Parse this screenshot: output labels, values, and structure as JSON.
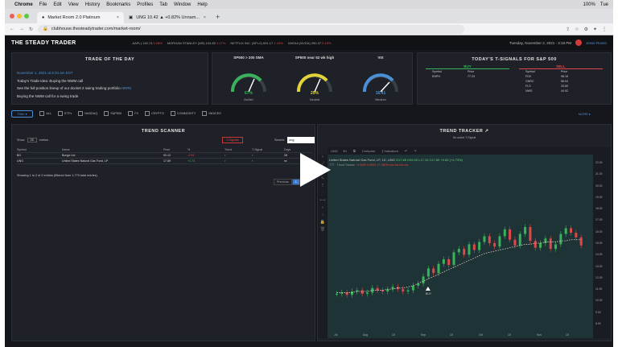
{
  "menubar": {
    "apple": "",
    "app": "Chrome",
    "items": [
      "File",
      "Edit",
      "View",
      "History",
      "Bookmarks",
      "Profiles",
      "Tab",
      "Window",
      "Help"
    ],
    "status": "100%",
    "clock": "Tue"
  },
  "tabs": [
    {
      "label": "Market Room 2.0 Platinum",
      "active": true
    },
    {
      "label": "UNG 10.42 ▲ +0.82% Unnam...",
      "active": false
    }
  ],
  "address": {
    "url": "clubhouse.thesteadytrader.com/market-room/"
  },
  "header": {
    "logo": "THE STEADY TRADER",
    "ticker": [
      {
        "t": "AAPL) 149.74",
        "r": "0.28%"
      },
      {
        "t": "MORGAN STANLEY (MS) 104.83",
        "r": "1.17%"
      },
      {
        "t": "NETFLIX INC. (NFLX) 691.17",
        "r": "1.19%"
      },
      {
        "t": "NVIDIA (NVDA) 250.37",
        "r": "0.19%"
      }
    ],
    "date": "Tuesday, November 2, 2021 - 3:18 PM",
    "user": "Jesse Rosen"
  },
  "trade_of_day": {
    "title": "TRADE OF THE DAY",
    "date": "November 1, 2021 at 9:34 am EST",
    "lines": [
      "Today's Trade Idea: Buying the NWM call",
      "See the full position lineup of our docket 2 swing trading portfolio",
      "Buying the NWM call for a swing trade"
    ],
    "link": "HERE"
  },
  "gauges": [
    {
      "title": "SP500 > 200 SMA",
      "value": "67%",
      "label": "Bullish",
      "color": "#39b35b"
    },
    {
      "title": "SP500 near 52 wk high",
      "value": "29%",
      "label": "Neutral",
      "color": "#e0d43a"
    },
    {
      "title": "VIX",
      "value": "16.41",
      "label": "Medium",
      "color": "#4b8fd6"
    }
  ],
  "signals": {
    "title": "TODAY'S T-SIGNALS FOR S&P 500",
    "buy": {
      "label": "BUY",
      "color": "#39b35b",
      "headers": [
        "Symbol",
        "Price"
      ],
      "rows": [
        [
          "ENPH",
          "77.23"
        ]
      ]
    },
    "sell": {
      "label": "SELL",
      "color": "#e04848",
      "headers": [
        "Symbol",
        "Price"
      ],
      "rows": [
        [
          "FDX",
          "98.16"
        ],
        [
          "GNRC",
          "56.04"
        ],
        [
          "FLS",
          "33.89"
        ],
        [
          "NWS",
          "44.92"
        ]
      ]
    }
  },
  "filters": {
    "button": "Filter ▾",
    "items": [
      "ALL",
      "ETFs",
      "NASDAQ",
      "S&P500",
      "FX",
      "CRYPTO",
      "COMMODITY",
      "INDICES"
    ],
    "more": "MORE ▸"
  },
  "scanner": {
    "title": "TREND SCANNER",
    "show": "Show",
    "entries_val": "25",
    "entries": "entries",
    "tsignal": "T-Signals",
    "search_label": "Search:",
    "search_value": "ung",
    "headers": [
      "Symbol",
      "Name",
      "Price",
      "%",
      "Trend",
      "T-Signal",
      "Days"
    ],
    "rows": [
      [
        "BG",
        "Bunge Ltd",
        "92.12",
        "-0.94",
        "↑",
        "↑",
        "28"
      ],
      [
        "UNG",
        "United States Natural Gas Fund, LP",
        "17.89",
        "+4.73",
        "↑",
        "↑",
        "xx"
      ]
    ],
    "showing": "Showing 1 to 2 of 2 entries (filtered from 1,779 total entries)",
    "prev": "Previous",
    "page": "1"
  },
  "tracker": {
    "title": "TREND TRACKER ↗",
    "subtitle": "No active T-Signal",
    "symbol": "UNG",
    "toolbar": [
      "1D",
      "⧉",
      "Compare",
      "⨍ Indicators",
      "↶",
      "↷"
    ],
    "legend1": "United States Natural Gas Fund, LP, 1D, UNG",
    "legend1_vals": "O17.66 H19.00 L17.10 C17.89 +0.82 (+4.73%)",
    "legend2_a": "TTT · Trend Tracker ·",
    "legend2_b": "0.0000 0.0000 17.7887b n/a n/a n/a n/a",
    "x_ticks": [
      "Jul",
      "Aug",
      "15",
      "Sep",
      "15",
      "Oct",
      "15",
      "Nov",
      "15"
    ],
    "y_ticks": [
      "22.00",
      "21.00",
      "20.00",
      "19.00",
      "18.00",
      "17.00",
      "16.00",
      "15.00",
      "14.00",
      "13.00",
      "12.00",
      "11.00",
      "10.00",
      "9.00",
      "8.00"
    ]
  },
  "chart_data": {
    "type": "candlestick",
    "series": [
      {
        "name": "UNG",
        "values": [
          10.6,
          10.7,
          10.5,
          10.8,
          10.9,
          10.6,
          10.7,
          11.1,
          10.9,
          10.8,
          11.0,
          11.2,
          11.0,
          10.8,
          10.9,
          11.3,
          11.5,
          12.1,
          12.8,
          12.4,
          13.2,
          13.6,
          13.1,
          14.2,
          14.5,
          14.0,
          14.9,
          14.4,
          15.1,
          15.6,
          15.0,
          14.7,
          15.6,
          16.2,
          15.3,
          14.8,
          15.8,
          16.4,
          15.2,
          14.6,
          15.0,
          15.4,
          14.5,
          14.9,
          15.8,
          16.3,
          15.9,
          15.5,
          14.8
        ]
      },
      {
        "name": "trend",
        "values": [
          10.7,
          10.7,
          10.7,
          10.7,
          10.8,
          10.8,
          10.8,
          10.9,
          10.9,
          10.9,
          11.0,
          11.0,
          11.1,
          11.1,
          11.2,
          11.3,
          11.5,
          11.7,
          11.9,
          12.1,
          12.3,
          12.5,
          12.7,
          12.9,
          13.1,
          13.3,
          13.5,
          13.7,
          13.9,
          14.1,
          14.2,
          14.3,
          14.4,
          14.5,
          14.6,
          14.7,
          14.8,
          14.9,
          14.9,
          15.0,
          15.0,
          15.1,
          15.1,
          15.1,
          15.2,
          15.2,
          15.3,
          15.3,
          15.3
        ]
      }
    ],
    "ylim": [
      8,
      22
    ],
    "marker": "BUY"
  }
}
